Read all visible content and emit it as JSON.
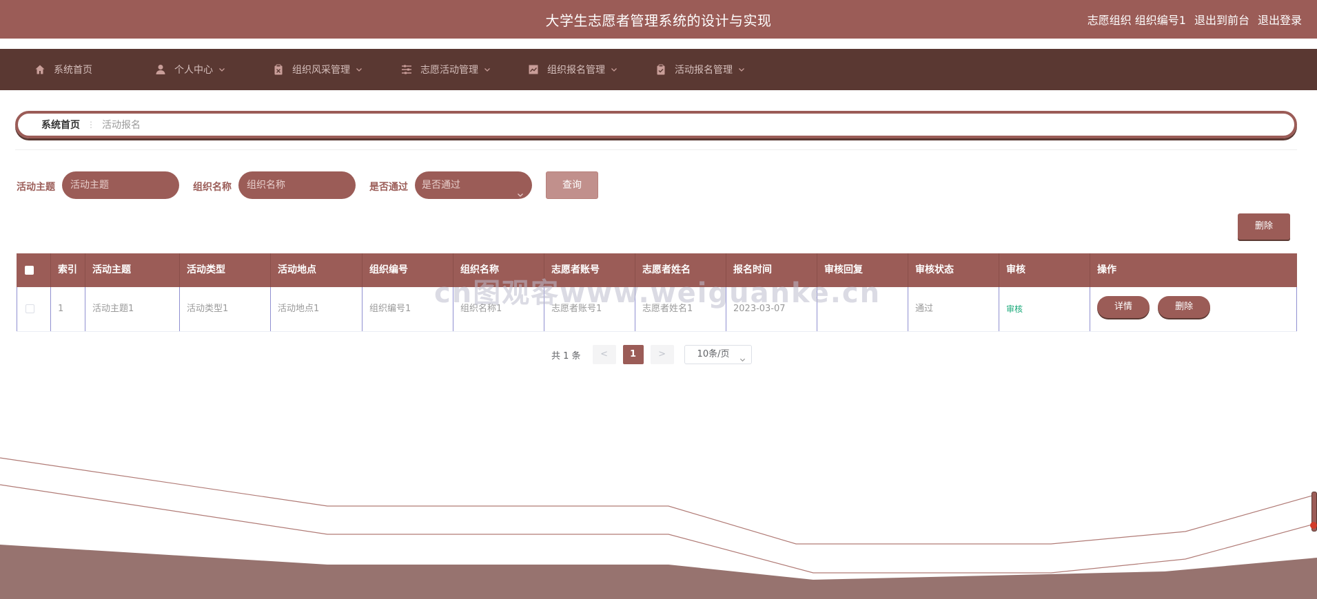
{
  "header": {
    "title": "大学生志愿者管理系统的设计与实现",
    "user_info": "志愿组织 组织编号1",
    "front_link": "退出到前台",
    "logout_link": "退出登录"
  },
  "nav": {
    "items": [
      {
        "label": "系统首页",
        "icon": "home-icon"
      },
      {
        "label": "个人中心",
        "icon": "user-icon"
      },
      {
        "label": "组织风采管理",
        "icon": "clipboard-x-icon"
      },
      {
        "label": "志愿活动管理",
        "icon": "sliders-icon"
      },
      {
        "label": "组织报名管理",
        "icon": "chart-icon"
      },
      {
        "label": "活动报名管理",
        "icon": "clipboard-check-icon"
      }
    ]
  },
  "breadcrumb": {
    "home": "系统首页",
    "current": "活动报名"
  },
  "search": {
    "theme_label": "活动主题",
    "theme_placeholder": "活动主题",
    "org_label": "组织名称",
    "org_placeholder": "组织名称",
    "pass_label": "是否通过",
    "pass_placeholder": "是否通过",
    "query_button": "查询"
  },
  "toolbar": {
    "delete_button": "删除"
  },
  "table": {
    "columns": [
      "索引",
      "活动主题",
      "活动类型",
      "活动地点",
      "组织编号",
      "组织名称",
      "志愿者账号",
      "志愿者姓名",
      "报名时间",
      "审核回复",
      "审核状态",
      "审核",
      "操作"
    ],
    "rows": [
      {
        "index": "1",
        "theme": "活动主题1",
        "type": "活动类型1",
        "place": "活动地点1",
        "org_no": "组织编号1",
        "org_name": "组织名称1",
        "vol_account": "志愿者账号1",
        "vol_name": "志愿者姓名1",
        "signup_time": "2023-03-07",
        "reply": "",
        "status": "通过",
        "audit": "审核",
        "detail_button": "详情",
        "delete_button": "删除"
      }
    ]
  },
  "pagination": {
    "total": "共 1 条",
    "prev": "<",
    "current": "1",
    "next": ">",
    "page_size": "10条/页"
  },
  "watermark": "cn图观客www.weiguanke.cn",
  "colors": {
    "primary": "#9b5c57",
    "dark": "#5a3832",
    "audit": "#19a979"
  }
}
